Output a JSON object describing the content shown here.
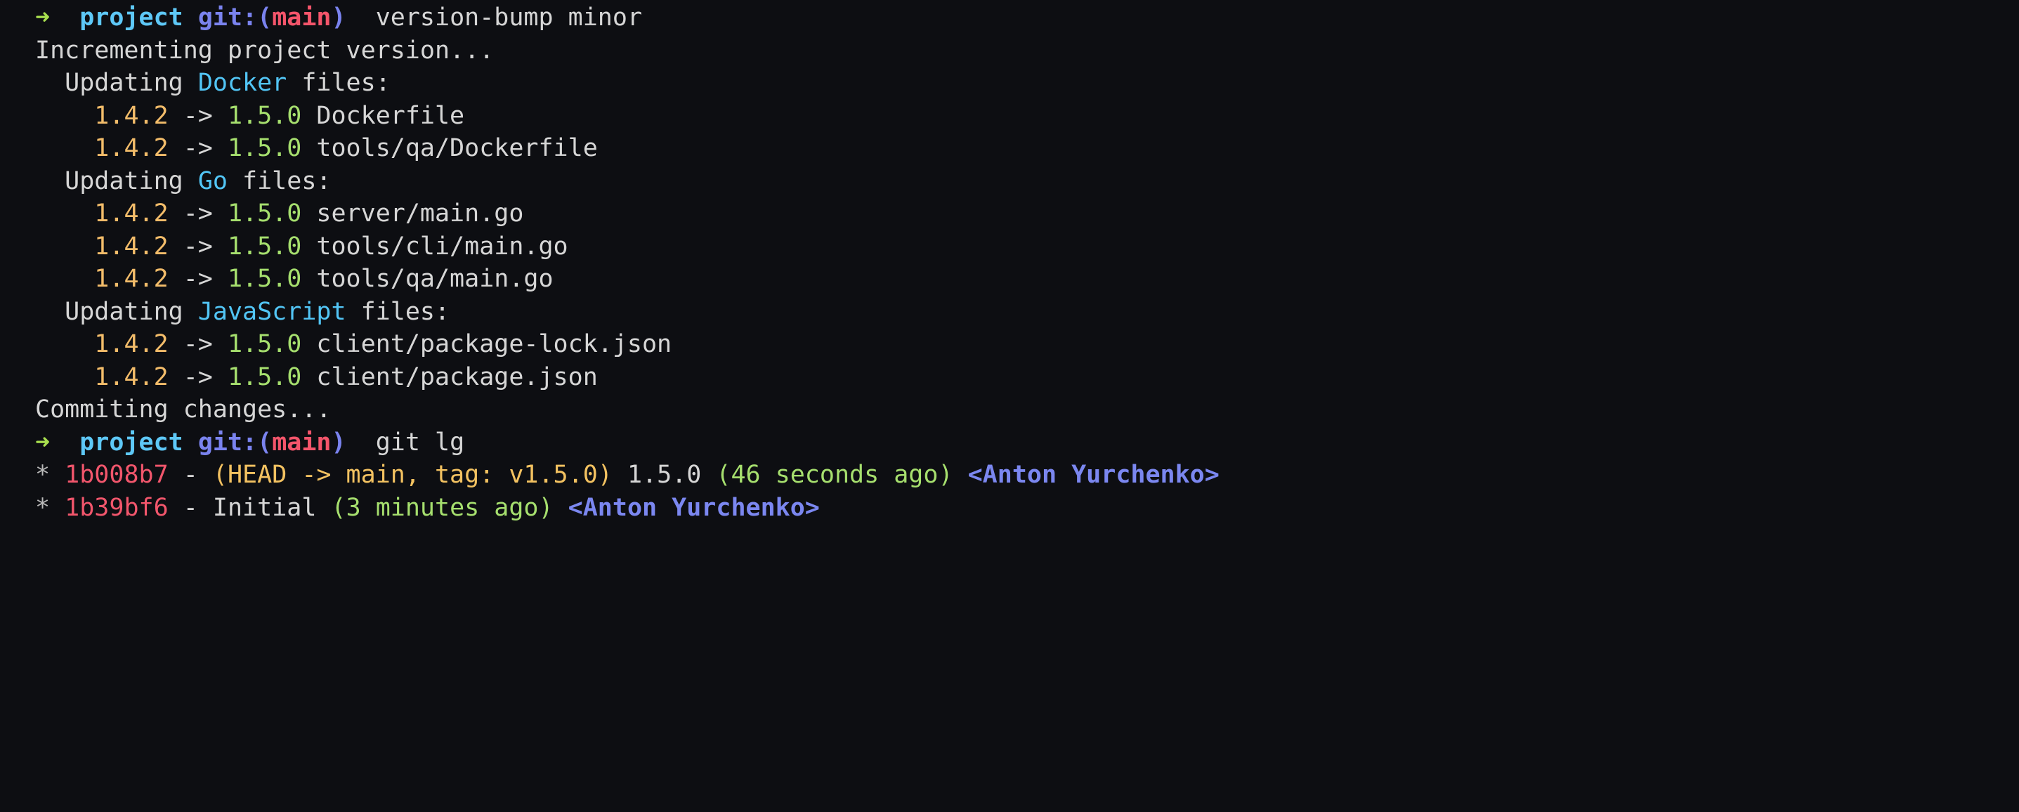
{
  "terminal": {
    "background": "#0d0e12",
    "foreground": "#d6d6d6",
    "font_size_px": 35,
    "colors": {
      "prompt_arrow": "#a9e04f",
      "dir_cyan": "#5ec8f7",
      "git_blue": "#7a83ef",
      "branch_red": "#f4556b",
      "language_cyan": "#52c5f5",
      "old_version_orange": "#f2bc6a",
      "new_version_green": "#a6df6e",
      "commit_hash_red": "#f4556b",
      "ref_yellow": "#f3c261",
      "relative_time_green": "#a6df6e",
      "author_blue": "#7b87f0",
      "plain_white": "#d6d6d6"
    },
    "prompt": {
      "arrow": "➜",
      "directory": "project",
      "git_prefix": "git:(",
      "branch": "main",
      "git_suffix": ")"
    },
    "lines": [
      {
        "id": "prompt-version-bump",
        "type": "prompt",
        "command": "version-bump minor"
      },
      {
        "id": "incrementing",
        "type": "output",
        "text": "Incrementing project version..."
      },
      {
        "id": "updating-docker-header",
        "type": "section-header",
        "indent": "  ",
        "prefix": "Updating ",
        "language": "Docker",
        "suffix": " files:"
      },
      {
        "id": "docker-file-1",
        "type": "bump",
        "indent": "    ",
        "old": "1.4.2",
        "arrow": "->",
        "new": "1.5.0",
        "file": "Dockerfile"
      },
      {
        "id": "docker-file-2",
        "type": "bump",
        "indent": "    ",
        "old": "1.4.2",
        "arrow": "->",
        "new": "1.5.0",
        "file": "tools/qa/Dockerfile"
      },
      {
        "id": "updating-go-header",
        "type": "section-header",
        "indent": "  ",
        "prefix": "Updating ",
        "language": "Go",
        "suffix": " files:"
      },
      {
        "id": "go-file-1",
        "type": "bump",
        "indent": "    ",
        "old": "1.4.2",
        "arrow": "->",
        "new": "1.5.0",
        "file": "server/main.go"
      },
      {
        "id": "go-file-2",
        "type": "bump",
        "indent": "    ",
        "old": "1.4.2",
        "arrow": "->",
        "new": "1.5.0",
        "file": "tools/cli/main.go"
      },
      {
        "id": "go-file-3",
        "type": "bump",
        "indent": "    ",
        "old": "1.4.2",
        "arrow": "->",
        "new": "1.5.0",
        "file": "tools/qa/main.go"
      },
      {
        "id": "updating-js-header",
        "type": "section-header",
        "indent": "  ",
        "prefix": "Updating ",
        "language": "JavaScript",
        "suffix": " files:"
      },
      {
        "id": "js-file-1",
        "type": "bump",
        "indent": "    ",
        "old": "1.4.2",
        "arrow": "->",
        "new": "1.5.0",
        "file": "client/package-lock.json"
      },
      {
        "id": "js-file-2",
        "type": "bump",
        "indent": "    ",
        "old": "1.4.2",
        "arrow": "->",
        "new": "1.5.0",
        "file": "client/package.json"
      },
      {
        "id": "commiting",
        "type": "output",
        "text": "Commiting changes..."
      },
      {
        "id": "prompt-git-lg",
        "type": "prompt",
        "command": "git lg"
      },
      {
        "id": "git-log-1",
        "type": "git-log",
        "graph": "*",
        "hash": "1b008b7",
        "dash": "-",
        "refs": "(HEAD -> main, tag: v1.5.0)",
        "subject": "1.5.0",
        "relative_time": "(46 seconds ago)",
        "author": "<Anton Yurchenko>"
      },
      {
        "id": "git-log-2",
        "type": "git-log",
        "graph": "*",
        "hash": "1b39bf6",
        "dash": "-",
        "refs": "",
        "subject": "Initial",
        "relative_time": "(3 minutes ago)",
        "author": "<Anton Yurchenko>"
      }
    ]
  }
}
